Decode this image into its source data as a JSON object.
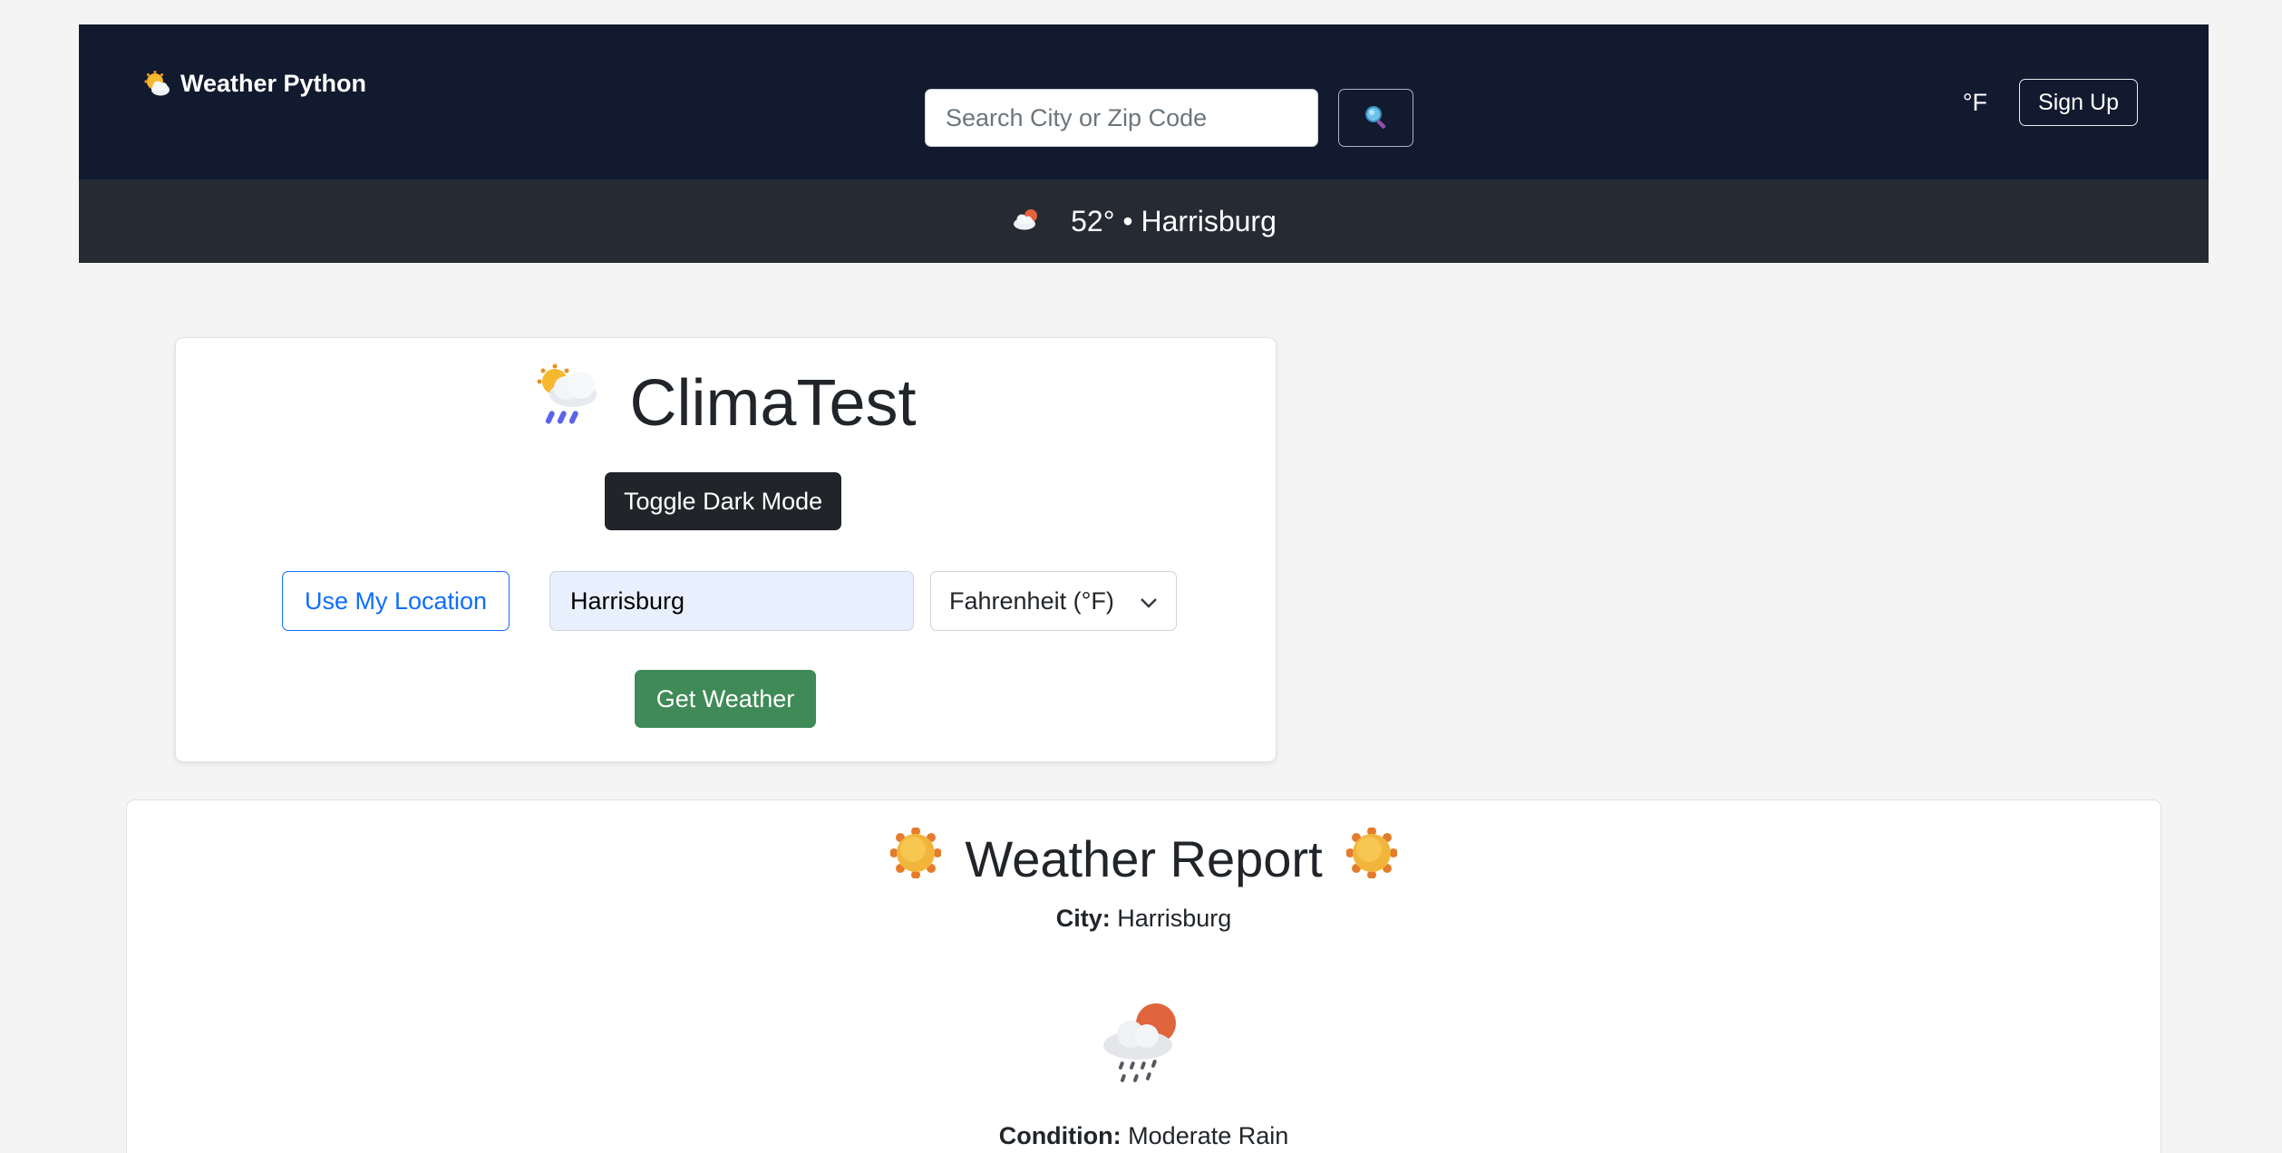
{
  "navbar": {
    "brand": "Weather Python",
    "brand_icon": "sun-behind-cloud-icon",
    "search": {
      "placeholder": "Search City or Zip Code",
      "value": "",
      "button_icon": "magnifier-icon"
    },
    "unit_label": "°F",
    "signup_label": "Sign Up"
  },
  "subbar": {
    "icon": "sun-behind-cloud-icon",
    "text": "52° • Harrisburg"
  },
  "main_card": {
    "title": "ClimaTest",
    "title_icon": "sun-behind-rain-cloud-icon",
    "toggle_label": "Toggle Dark Mode",
    "location_button_label": "Use My Location",
    "city_input_value": "Harrisburg",
    "unit_select_value": "Fahrenheit (°F)",
    "submit_label": "Get Weather"
  },
  "report": {
    "title": "Weather Report",
    "title_icon": "sun-icon",
    "city_label": "City:",
    "city_value": "Harrisburg",
    "condition_icon": "sun-behind-rain-cloud-icon",
    "condition_label": "Condition:",
    "condition_value": "Moderate Rain"
  },
  "colors": {
    "navbar_bg": "#111a2e",
    "subbar_bg": "#262b33",
    "page_bg": "#f4f4f4",
    "primary": "#0d6efd",
    "success": "#3f8a57",
    "dark": "#212529"
  }
}
